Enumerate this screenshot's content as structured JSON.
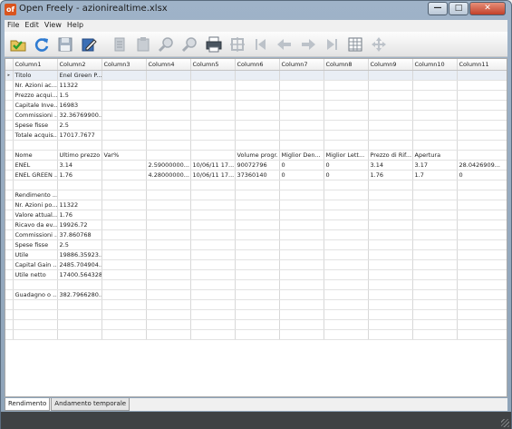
{
  "window": {
    "app_icon": "of",
    "title": "Open Freely - azionirealtime.xlsx"
  },
  "menu": [
    "File",
    "Edit",
    "View",
    "Help"
  ],
  "toolbar": {
    "icons": [
      "open-icon",
      "refresh-icon",
      "save-icon",
      "edit-icon",
      "copy-icon",
      "paste-icon",
      "zoom-in-icon",
      "zoom-out-icon",
      "print-icon",
      "fit-icon",
      "first-icon",
      "prev-icon",
      "next-icon",
      "last-icon",
      "grid-icon",
      "move-icon"
    ]
  },
  "sheet": {
    "columns": [
      "Column1",
      "Column2",
      "Column3",
      "Column4",
      "Column5",
      "Column6",
      "Column7",
      "Column8",
      "Column9",
      "Column10",
      "Column11"
    ],
    "rows": [
      [
        "Titolo",
        "Enel Green P...",
        "",
        "",
        "",
        "",
        "",
        "",
        "",
        "",
        ""
      ],
      [
        "Nr. Azioni ac...",
        "11322",
        "",
        "",
        "",
        "",
        "",
        "",
        "",
        "",
        ""
      ],
      [
        "Prezzo acqui...",
        "1.5",
        "",
        "",
        "",
        "",
        "",
        "",
        "",
        "",
        ""
      ],
      [
        "Capitale Inve...",
        "16983",
        "",
        "",
        "",
        "",
        "",
        "",
        "",
        "",
        ""
      ],
      [
        "Commissioni ...",
        "32.36769900...",
        "",
        "",
        "",
        "",
        "",
        "",
        "",
        "",
        ""
      ],
      [
        "Spese fisse",
        "2.5",
        "",
        "",
        "",
        "",
        "",
        "",
        "",
        "",
        ""
      ],
      [
        "Totale acquis...",
        "17017.7677",
        "",
        "",
        "",
        "",
        "",
        "",
        "",
        "",
        ""
      ],
      [
        "",
        "",
        "",
        "",
        "",
        "",
        "",
        "",
        "",
        "",
        ""
      ],
      [
        "Nome",
        "Ultimo prezzo",
        "Var%",
        "",
        "",
        "Volume progr.",
        "Miglior Den...",
        "Miglior Lett...",
        "Prezzo di Rif...",
        "Apertura",
        ""
      ],
      [
        "ENEL",
        "3.14",
        "",
        "2.59000000...",
        "10/06/11 17...",
        "90072796",
        "0",
        "0",
        "3.14",
        "3.17",
        "28.0426909..."
      ],
      [
        "ENEL GREEN ...",
        "1.76",
        "",
        "4.28000000...",
        "10/06/11 17...",
        "37360140",
        "0",
        "0",
        "1.76",
        "1.7",
        "0"
      ],
      [
        "",
        "",
        "",
        "",
        "",
        "",
        "",
        "",
        "",
        "",
        ""
      ],
      [
        "Rendimento ...",
        "",
        "",
        "",
        "",
        "",
        "",
        "",
        "",
        "",
        ""
      ],
      [
        "Nr. Azioni po...",
        "11322",
        "",
        "",
        "",
        "",
        "",
        "",
        "",
        "",
        ""
      ],
      [
        "Valore attual...",
        "1.76",
        "",
        "",
        "",
        "",
        "",
        "",
        "",
        "",
        ""
      ],
      [
        "Ricavo da ev...",
        "19926.72",
        "",
        "",
        "",
        "",
        "",
        "",
        "",
        "",
        ""
      ],
      [
        "Commissioni ...",
        "37.860768",
        "",
        "",
        "",
        "",
        "",
        "",
        "",
        "",
        ""
      ],
      [
        "Spese fisse",
        "2.5",
        "",
        "",
        "",
        "",
        "",
        "",
        "",
        "",
        ""
      ],
      [
        "Utile",
        "19886.35923...",
        "",
        "",
        "",
        "",
        "",
        "",
        "",
        "",
        ""
      ],
      [
        "Capital Gain ...",
        "2485.704904...",
        "",
        "",
        "",
        "",
        "",
        "",
        "",
        "",
        ""
      ],
      [
        "Utile netto",
        "17400.564328",
        "",
        "",
        "",
        "",
        "",
        "",
        "",
        "",
        ""
      ],
      [
        "",
        "",
        "",
        "",
        "",
        "",
        "",
        "",
        "",
        "",
        ""
      ],
      [
        "Guadagno o ...",
        "382.7966280...",
        "",
        "",
        "",
        "",
        "",
        "",
        "",
        "",
        ""
      ]
    ]
  },
  "tabs": [
    "Rendimento",
    "Andamento temporale"
  ],
  "active_tab": "Rendimento"
}
